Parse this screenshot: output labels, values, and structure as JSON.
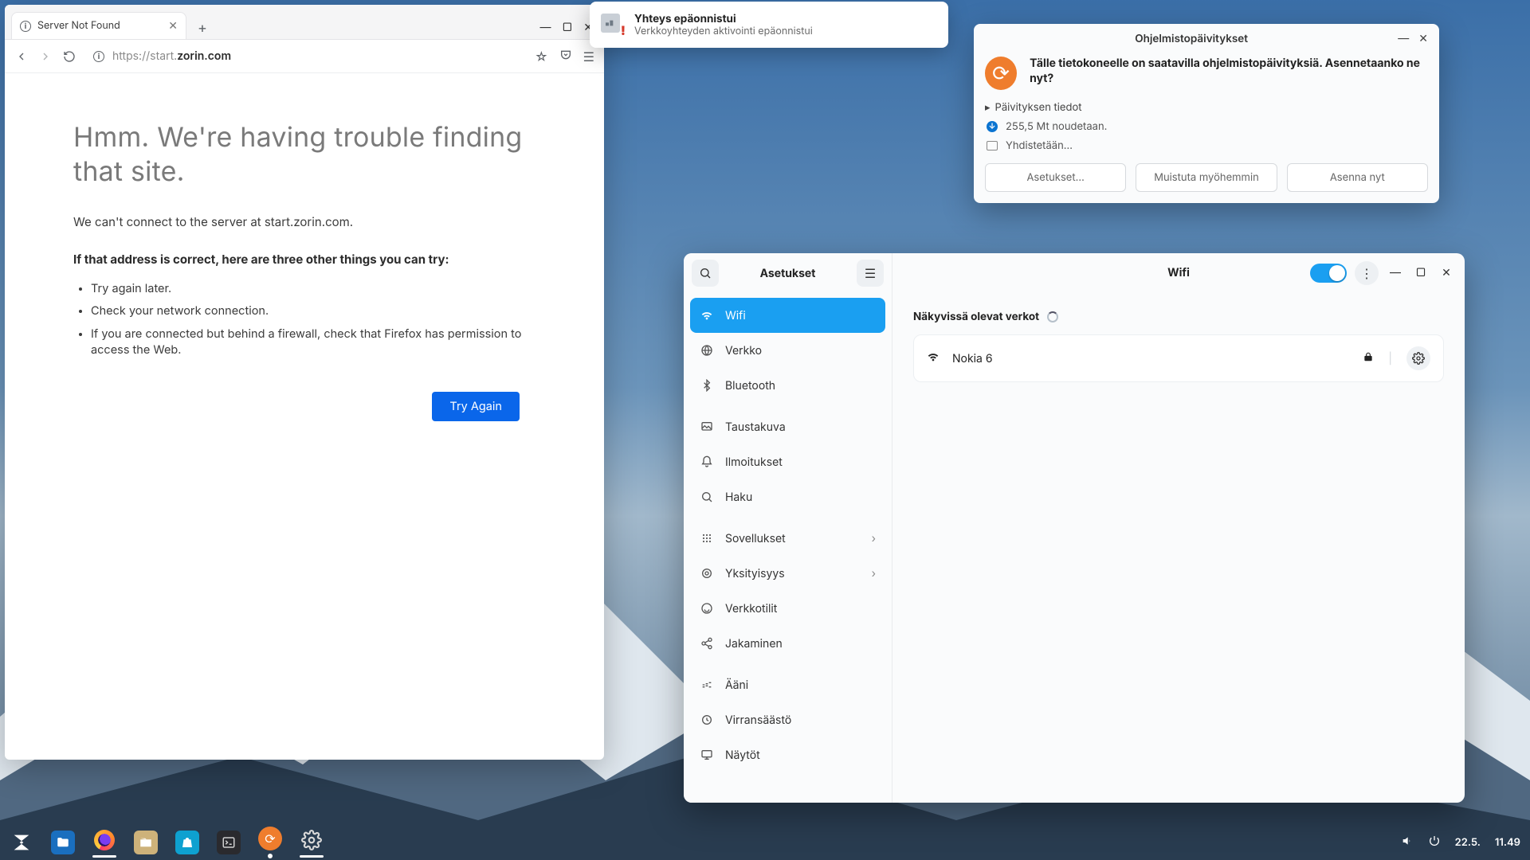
{
  "browser": {
    "tab_title": "Server Not Found",
    "url_proto": "https://start.",
    "url_host": "zorin.com",
    "error_title": "Hmm. We're having trouble finding that site.",
    "error_lead": "We can't connect to the server at start.zorin.com.",
    "error_sub": "If that address is correct, here are three other things you can try:",
    "bullets": [
      "Try again later.",
      "Check your network connection.",
      "If you are connected but behind a firewall, check that Firefox has permission to access the Web."
    ],
    "try_again": "Try Again"
  },
  "toast": {
    "title": "Yhteys epäonnistui",
    "subtitle": "Verkkoyhteyden aktivointi epäonnistui"
  },
  "updates": {
    "title": "Ohjelmistopäivitykset",
    "headline": "Tälle tietokoneelle on saatavilla ohjelmistopäivityksiä. Asennetaanko ne nyt?",
    "details_label": "Päivityksen tiedot",
    "download_line": "255,5 Mt noudetaan.",
    "connect_line": "Yhdistetään…",
    "btn_settings": "Asetukset…",
    "btn_later": "Muistuta myöhemmin",
    "btn_install": "Asenna nyt"
  },
  "settings": {
    "left_title": "Asetukset",
    "items": [
      "Wifi",
      "Verkko",
      "Bluetooth",
      "Taustakuva",
      "Ilmoitukset",
      "Haku",
      "Sovellukset",
      "Yksityisyys",
      "Verkkotilit",
      "Jakaminen",
      "Ääni",
      "Virransäästö",
      "Näytöt"
    ],
    "right_title": "Wifi",
    "networks_label": "Näkyvissä olevat verkot",
    "network_name": "Nokia 6"
  },
  "taskbar": {
    "date": "22.5.",
    "time": "11.49"
  }
}
